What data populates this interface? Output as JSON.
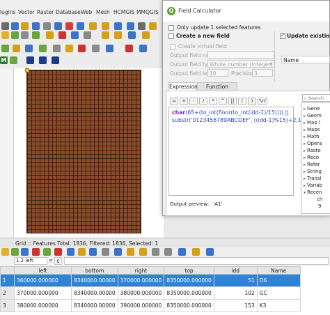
{
  "menu": [
    "lugins",
    "Vector",
    "Raster",
    "Database",
    "Web",
    "Mesh",
    "HCMGIS",
    "MMQGIS"
  ],
  "colors": {
    "grid_fill": "#8a4b2a",
    "selection": "#2f82d6",
    "qgis_green": "#5aa02c",
    "expr_blue": "#2a45c4",
    "expr_purple": "#7b1fb3"
  },
  "dialog": {
    "title": "Field Calculator",
    "only_update_selected": "Only update 1 selected features",
    "create_new_field": "Create a new field",
    "create_virtual_field": "Create virtual field",
    "output_field_name_label": "Output field name",
    "output_field_type_label": "Output field type",
    "output_field_type_value": "Whole number (integer)",
    "output_field_length_label": "Output field length",
    "output_field_length_value": "10",
    "precision_label": "Precision",
    "precision_value": "3",
    "update_existing_field": "Update existing field",
    "update_existing_field_value": "Name",
    "tabs": [
      "Expression",
      "Function Editor"
    ],
    "operators": [
      "=",
      "+",
      "-",
      "/",
      "*",
      "^",
      "||",
      "(",
      ")",
      "'\\n'"
    ],
    "expression_line1_fn": "char",
    "expression_line1_rest": "(65+(to_int(floor(to_int(idd-1)/15)))) ||",
    "expression_line2_fn": "substr",
    "expression_line2_rest": "('0123456789ABCDEF', ((idd-1)%15)+2,1)",
    "search_placeholder": "Search",
    "output_preview_label": "Output preview:",
    "output_preview_value": "'A1'",
    "function_groups": [
      "Gene",
      "Geom",
      "Map l",
      "Maps",
      "Math",
      "Opera",
      "Raste",
      "Reco",
      "Refer",
      "String",
      "Transl",
      "Variab",
      "Recen"
    ],
    "recent_children": [
      "ch",
      "9"
    ]
  },
  "attribute_table": {
    "title": "Grid :: Features Total: 1836, Filtered: 1836, Selected: 1",
    "field_selector": "1.2  left",
    "formula_button": "ε",
    "columns": [
      "left",
      "bottom",
      "right",
      "top",
      "idd",
      "Name"
    ],
    "rows": [
      {
        "num": "1",
        "left": "360000.000000",
        "bottom": "8340000.00000",
        "right": "370000.000000",
        "top": "8350000.000000",
        "idd": "51",
        "name": "D6"
      },
      {
        "num": "2",
        "left": "370000.000000",
        "bottom": "8340000.00000",
        "right": "380000.000000",
        "top": "8350000.000000",
        "idd": "102",
        "name": "GC"
      },
      {
        "num": "3",
        "left": "380000.000000",
        "bottom": "8340000.00000",
        "right": "390000.000000",
        "top": "8350000.000000",
        "idd": "153",
        "name": "K3"
      }
    ]
  }
}
